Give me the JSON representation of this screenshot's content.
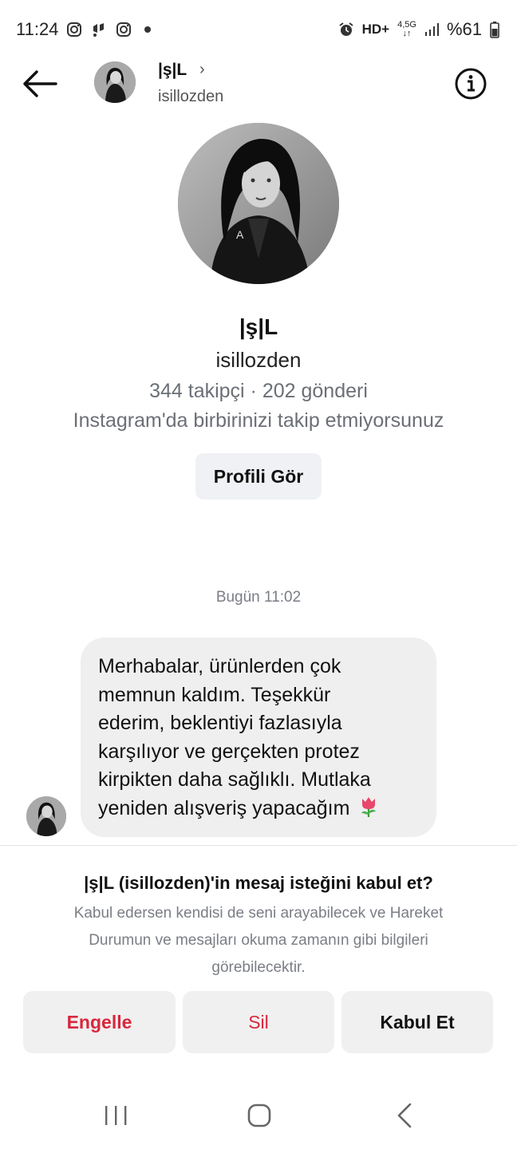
{
  "status_bar": {
    "time": "11:24",
    "network": "HD+",
    "network_small_top": "4,5G",
    "battery": "%61",
    "left_icons": [
      "instagram-icon",
      "notification-icon",
      "instagram-icon",
      "dot-icon"
    ],
    "right_icons": [
      "alarm-icon",
      "hd-icon",
      "data-icon",
      "signal-icon",
      "battery-icon"
    ]
  },
  "header": {
    "name": "|ş|L",
    "chevron": "›",
    "username": "isillozden"
  },
  "profile": {
    "name": "|ş|L",
    "username": "isillozden",
    "stats": "344 takipçi · 202 gönderi",
    "relation": "Instagram'da birbirinizi takip etmiyorsunuz",
    "view_profile_label": "Profili Gör"
  },
  "messages": {
    "timestamp": "Bugün 11:02",
    "items": [
      {
        "text": "Merhabalar, ürünlerden çok memnun kaldım. Teşekkür ederim, beklentiyi fazlasıyla karşılıyor ve gerçekten protez kirpikten daha sağlıklı. Mutlaka yeniden alışveriş yapacağım 🌷",
        "line1": "Merhabalar, ürünlerden çok",
        "line2": "memnun kaldım. Teşekkür",
        "line3": "ederim, beklentiyi fazlasıyla",
        "line4": "karşılıyor ve gerçekten protez",
        "line5": "kirpikten daha sağlıklı. Mutlaka",
        "line6": "yeniden alışveriş yapacağım"
      }
    ]
  },
  "request": {
    "title": "|ş|L (isillozden)'in mesaj isteğini kabul et?",
    "body_line1": "Kabul edersen kendisi de seni arayabilecek ve Hareket",
    "body_line2": "Durumun ve mesajları okuma zamanın gibi bilgileri",
    "body_line3": "görebilecektir.",
    "block_label": "Engelle",
    "delete_label": "Sil",
    "accept_label": "Kabul Et"
  },
  "colors": {
    "danger": "#d8283c",
    "button_bg": "#f0f0f0",
    "bubble_bg": "#efefef",
    "muted_text": "#6b6f76"
  }
}
